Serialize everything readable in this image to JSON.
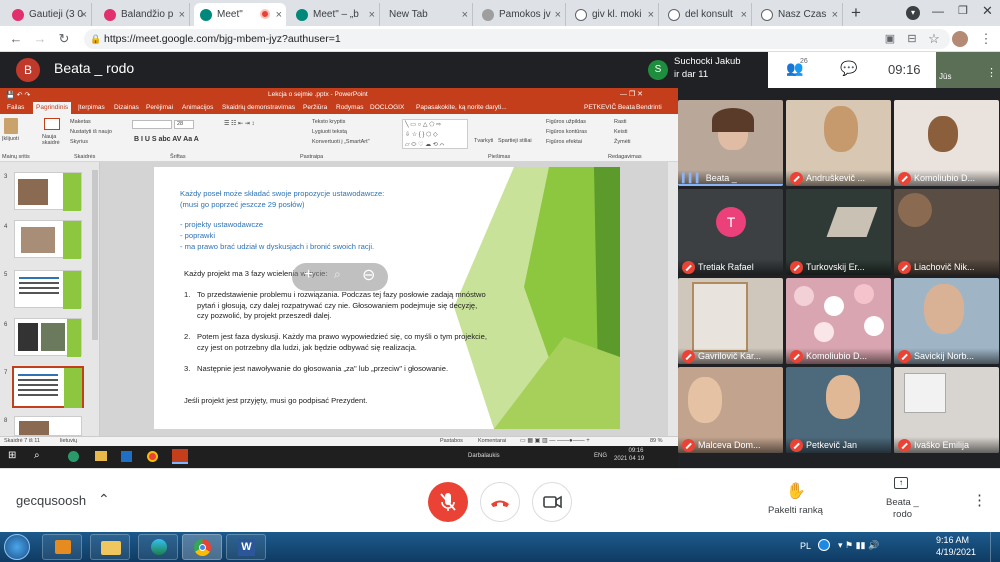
{
  "tabs": [
    {
      "label": "Gautieji (3 0",
      "color": "#e1306c"
    },
    {
      "label": "Balandžio p",
      "color": "#e1306c"
    },
    {
      "label": "Meet\" ",
      "color": "#00897b",
      "active": true
    },
    {
      "label": "Meet\" – „b",
      "color": "#00897b"
    },
    {
      "label": "New Tab",
      "color": "#ffffff"
    },
    {
      "label": "Pamokos jv",
      "color": "#9e9e9e"
    },
    {
      "label": "giv kl. moki",
      "color": "#5f6368"
    },
    {
      "label": "del konsult",
      "color": "#5f6368"
    },
    {
      "label": "Nasz Czas",
      "color": "#5f6368"
    }
  ],
  "address": {
    "url": "https://meet.google.com/bjg-mbem-jyz?authuser=1"
  },
  "meeting": {
    "presenter_name": "Beata _ rodo",
    "presenter_initial": "B",
    "top_user_initial": "S",
    "top_user_line1": "Suchocki Jakub",
    "top_user_line2": "ir dar 11",
    "participants_count": "26",
    "time": "09:16",
    "self_label": "Jūs",
    "meeting_code": "gecqusoosh",
    "raise_hand_label": "Pakelti ranką",
    "presenting_label_1": "Beata _",
    "presenting_label_2": "rodo"
  },
  "ppt": {
    "window_title": "Lekcja o sejmie .pptx - PowerPoint",
    "menu": [
      "Failas",
      "Pagrindinis",
      "Įterpimas",
      "Dizainas",
      "Perėjimai",
      "Animacijos",
      "Skaidrių demonstravimas",
      "Peržiūra",
      "Rodymas",
      "DOCLOGIX",
      "Papasakokite, ką norite daryti...",
      "PETKEVIČ Beata",
      "Bendrinti"
    ],
    "ribbon_groups": [
      "Mainų sritis",
      "Skaidrės",
      "Šriftas",
      "Pastraipa",
      "Piešimas",
      "Redagavimas"
    ],
    "ribbon_items": [
      "Įklijuoti",
      "Nauja skaidrė",
      "Maketas",
      "Nustatyti iš naujo",
      "Skyrius",
      "Teksto kryptis",
      "Lygiuoti tekstą",
      "Konvertuoti į „SmartArt\"",
      "Tvarkyti",
      "Spartieji stiliai",
      "Figūros užpildas",
      "Figūros kontūras",
      "Figūros efektai",
      "Rasti",
      "Keisti",
      "Žymėti"
    ],
    "font_size": "28",
    "status_left": "Skaidrė 7 iš 11",
    "status_lang": "lietuvių",
    "status_notes": "Pastabos",
    "status_comments": "Komentarai",
    "zoom": "89 %",
    "thumb_numbers": [
      "3",
      "4",
      "5",
      "6",
      "7",
      "8"
    ],
    "taskbar_time": "09:16",
    "taskbar_date": "2021 04 19",
    "taskbar_lang": "ENG",
    "taskbar_desktop": "Darbalaukis"
  },
  "slide": {
    "intro": "Każdy poseł może składać swoje propozycje ustawodawcze:",
    "intro2": "(musi go poprzeć jeszcze 29 posłów)",
    "bullets": [
      "- projekty ustawodawcze",
      "- poprawki",
      "- ma prawo brać udział w dyskusjach i bronić swoich racji."
    ],
    "phases_title": "Każdy projekt ma 3 fazy wcielenia w życie:",
    "phases": [
      "To przedstawienie problemu i rozwiązania. Podczas tej fazy posłowie zadają mnóstwo pytań i głosują, czy dalej rozpatrywać czy nie. Głosowaniem podejmuje się decyzję, czy pozwolić, by projekt przeszedł dalej.",
      "Potem jest faza dyskusji. Każdy ma prawo wypowiedzieć się, co myśli o tym projekcie, czy jest on potrzebny dla ludzi, jak będzie odbywać się realizacja.",
      "Następnie jest nawoływanie do głosowania „za\" lub „przeciw\" i głosowanie."
    ],
    "closing": "Jeśli projekt jest przyjęty, musi go podpisać Prezydent."
  },
  "participants": [
    {
      "name": "Beata _",
      "bg": "#b9a89a",
      "muted": false,
      "speaking": true
    },
    {
      "name": "Andruškevič ...",
      "bg": "#d8c7b3",
      "muted": true
    },
    {
      "name": "Komoliubio D...",
      "bg": "#e9e2dd",
      "muted": true
    },
    {
      "name": "Tretiak Rafael",
      "bg": "#3c4043",
      "muted": true,
      "avatar": "T"
    },
    {
      "name": "Turkovskij Er...",
      "bg": "#2f3a36",
      "muted": true
    },
    {
      "name": "Liachovič Nik...",
      "bg": "#5a4d43",
      "muted": true
    },
    {
      "name": "Gavrilovič Kar...",
      "bg": "#cfc6bc",
      "muted": true
    },
    {
      "name": "Komoliubio D...",
      "bg": "#d9a5b0",
      "muted": true
    },
    {
      "name": "Savickij Norb...",
      "bg": "#9fb5c6",
      "muted": true
    },
    {
      "name": "Malceva Dom...",
      "bg": "#c2a48e",
      "muted": true
    },
    {
      "name": "Petkevič Jan",
      "bg": "#4d6a7c",
      "muted": true
    },
    {
      "name": "Ivaško Emilija",
      "bg": "#d8d4cf",
      "muted": true
    }
  ],
  "system_tray": {
    "lang": "PL",
    "time": "9:16 AM",
    "date": "4/19/2021"
  },
  "colors": {
    "ppt_accent": "#c43e1c",
    "meet_red": "#ea4335",
    "slide_green": "#8dc63f",
    "slide_blue": "#2e74b5"
  }
}
